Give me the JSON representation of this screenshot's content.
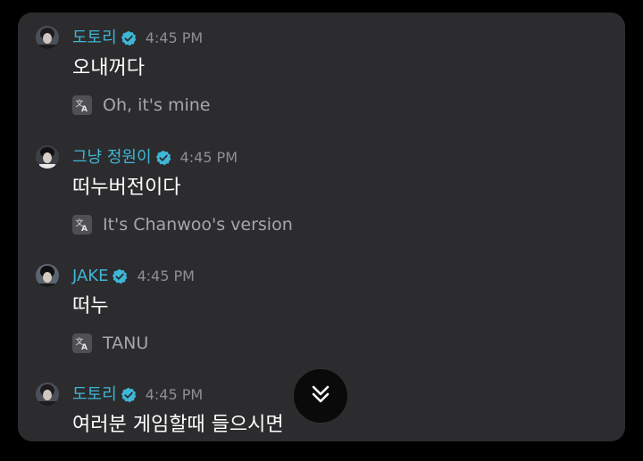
{
  "messages": [
    {
      "name": "도토리",
      "time": "4:45 PM",
      "text": "오내꺼다",
      "translation": "Oh, it's mine"
    },
    {
      "name": "그냥 정원이",
      "time": "4:45 PM",
      "text": "떠누버전이다",
      "translation": "It's Chanwoo's version"
    },
    {
      "name": "JAKE",
      "time": "4:45 PM",
      "text": "떠누",
      "translation": "TANU"
    },
    {
      "name": "도토리",
      "time": "4:45 PM",
      "text": "여러분 게임할때 들으시면"
    }
  ],
  "icons": {
    "verified": "verified-check-icon",
    "translate": "translate-icon",
    "scroll": "double-chevron-down-icon"
  },
  "colors": {
    "name": "#3fb6d6",
    "verified_badge": "#3fb6d6",
    "panel": "#2c2c2e",
    "background": "#000000"
  }
}
